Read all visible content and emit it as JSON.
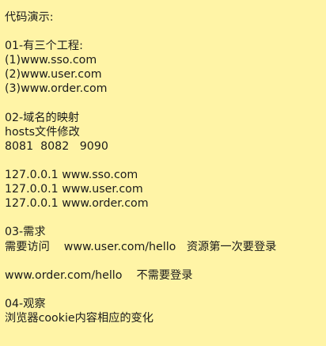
{
  "note": {
    "title": "代码演示:",
    "section1": {
      "heading": "01-有三个工程:",
      "items": [
        "(1)www.sso.com",
        "(2)www.user.com",
        "(3)www.order.com"
      ]
    },
    "section2": {
      "heading": "02-域名的映射",
      "hosts_label": "hosts文件修改",
      "ports": "8081  8082   9090",
      "mappings": [
        "127.0.0.1 www.sso.com",
        "127.0.0.1 www.user.com",
        "127.0.0.1 www.order.com"
      ]
    },
    "section3": {
      "heading": "03-需求",
      "requirement_1": "需要访问    www.user.com/hello   资源第一次要登录",
      "requirement_2": "www.order.com/hello    不需要登录"
    },
    "section4": {
      "heading": "04-观察",
      "body": "浏览器cookie内容相应的变化"
    }
  }
}
